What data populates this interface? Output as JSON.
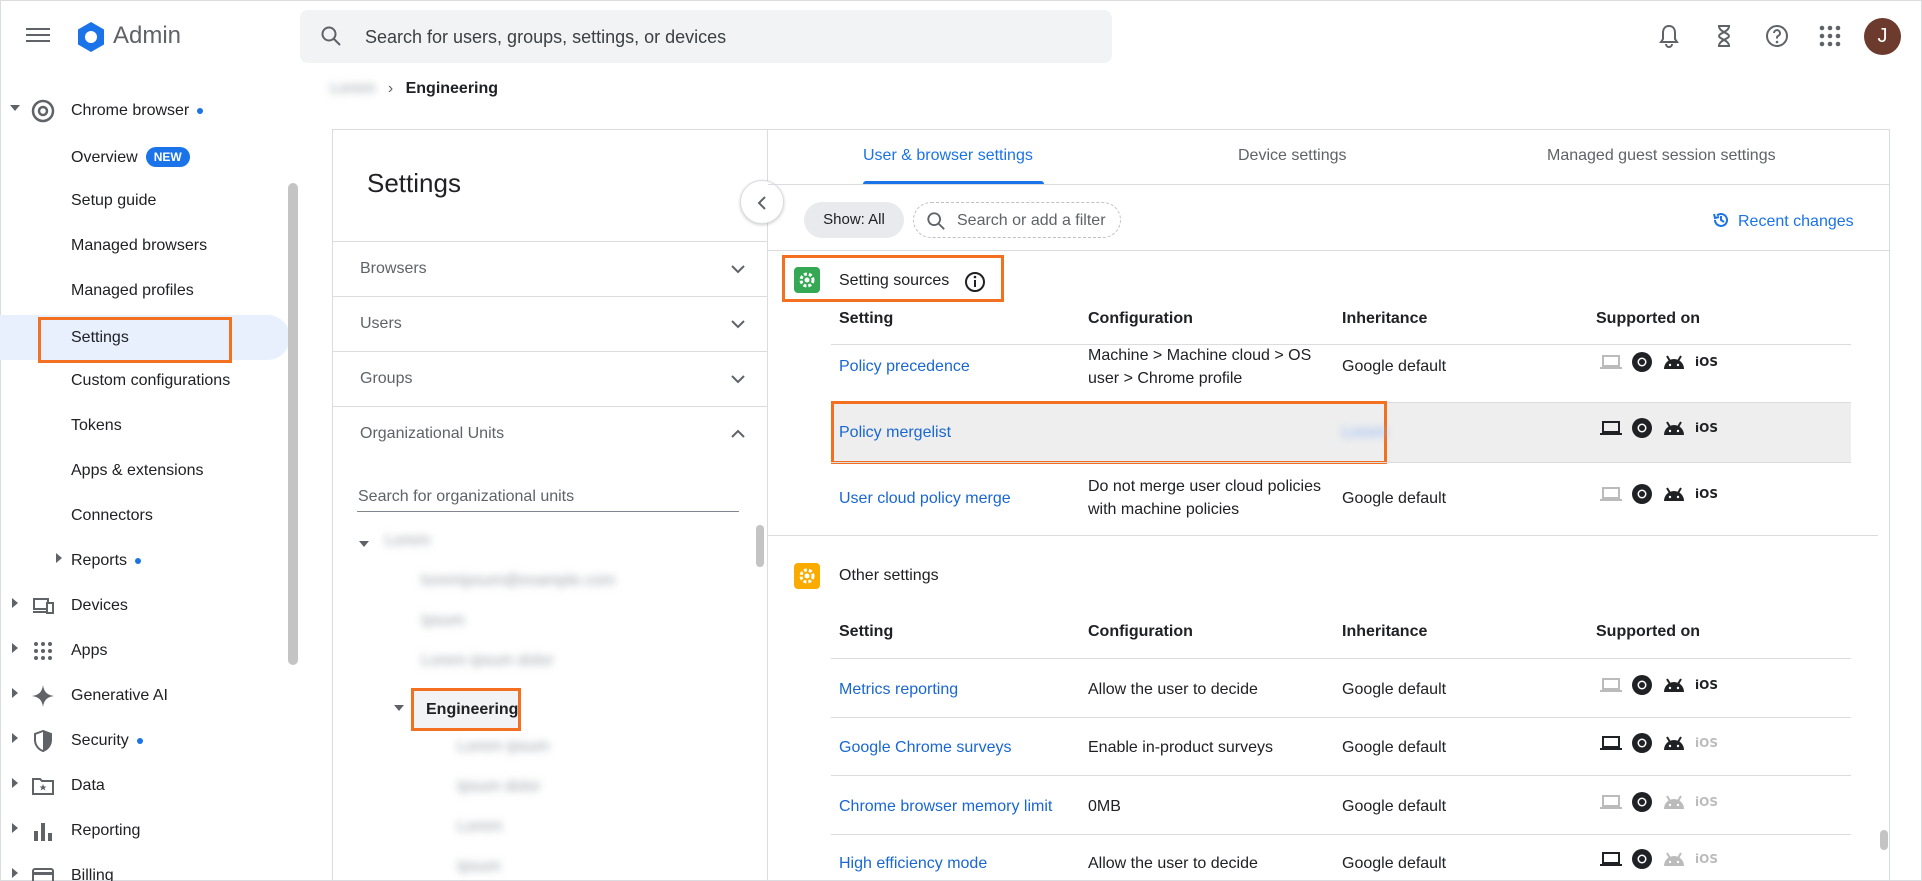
{
  "app": {
    "title": "Admin",
    "user_initial": "J"
  },
  "search": {
    "placeholder": "Search for users, groups, settings, or devices"
  },
  "nav": {
    "chrome": "Chrome browser",
    "overview": "Overview",
    "new_badge": "NEW",
    "setup_guide": "Setup guide",
    "managed_browsers": "Managed browsers",
    "managed_profiles": "Managed profiles",
    "settings": "Settings",
    "custom_configurations": "Custom configurations",
    "tokens": "Tokens",
    "apps_extensions": "Apps & extensions",
    "connectors": "Connectors",
    "reports": "Reports",
    "devices": "Devices",
    "apps": "Apps",
    "generative_ai": "Generative AI",
    "security": "Security",
    "data": "Data",
    "reporting": "Reporting",
    "billing": "Billing"
  },
  "breadcrumb": {
    "root": "Lorem",
    "current": "Engineering"
  },
  "settings_panel": {
    "title": "Settings",
    "browsers": "Browsers",
    "users": "Users",
    "groups": "Groups",
    "org_units": "Organizational Units",
    "ou_search_placeholder": "Search for organizational units",
    "tree": {
      "root": "Lorem",
      "child1": "loremipsum@example.com",
      "child2": "Ipsum",
      "child3": "Lorem ipsum dolor",
      "engineering": "Engineering",
      "sub1": "Lorem ipsum",
      "sub2": "Ipsum dolor",
      "sub3": "Lorem",
      "sub4": "Ipsum"
    }
  },
  "tabs": {
    "user_browser": "User & browser settings",
    "device": "Device settings",
    "guest": "Managed guest session settings"
  },
  "filters": {
    "show_all": "Show: All",
    "placeholder": "Search or add a filter",
    "recent_changes": "Recent changes"
  },
  "columns": {
    "setting": "Setting",
    "configuration": "Configuration",
    "inheritance": "Inheritance",
    "supported_on": "Supported on"
  },
  "sections": {
    "setting_sources": {
      "title": "Setting sources",
      "rows": [
        {
          "setting": "Policy precedence",
          "config_l1": "Machine > Machine cloud > OS",
          "config_l2": "user > Chrome profile",
          "inheritance": "Google default"
        },
        {
          "setting": "Policy mergelist",
          "config_l1": "",
          "config_l2": "",
          "inheritance": "Lorem"
        },
        {
          "setting": "User cloud policy merge",
          "config_l1": "Do not merge user cloud policies",
          "config_l2": "with machine policies",
          "inheritance": "Google default"
        }
      ]
    },
    "other_settings": {
      "title": "Other settings",
      "rows": [
        {
          "setting": "Metrics reporting",
          "config": "Allow the user to decide",
          "inheritance": "Google default"
        },
        {
          "setting": "Google Chrome surveys",
          "config": "Enable in-product surveys",
          "inheritance": "Google default"
        },
        {
          "setting": "Chrome browser memory limit",
          "config": "0MB",
          "inheritance": "Google default"
        },
        {
          "setting": "High efficiency mode",
          "config": "Allow the user to decide",
          "inheritance": "Google default"
        }
      ]
    }
  },
  "platform_labels": {
    "ios": "iOS"
  },
  "colors": {
    "accent": "#1a73e8",
    "highlight": "#f37021",
    "section_green": "#34a853",
    "section_orange": "#f9ab00"
  }
}
